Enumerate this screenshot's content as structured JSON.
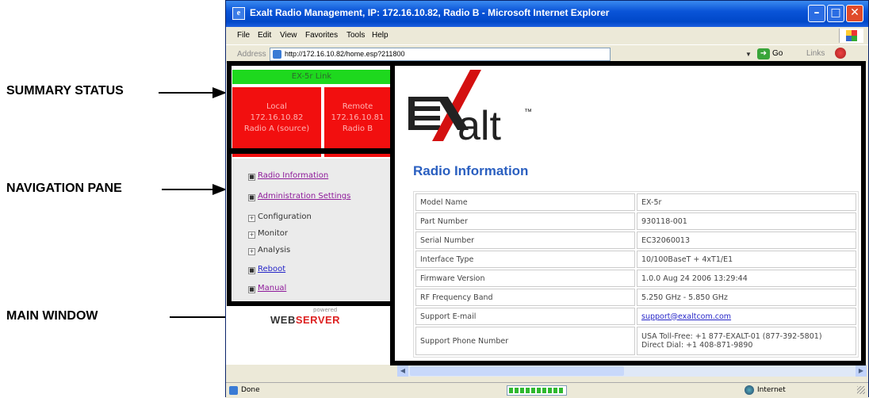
{
  "callouts": {
    "summary_status": "SUMMARY STATUS",
    "navigation_pane": "NAVIGATION PANE",
    "main_window": "MAIN WINDOW"
  },
  "window": {
    "title": "Exalt Radio Management, IP: 172.16.10.82, Radio B - Microsoft Internet Explorer",
    "minimize_glyph": "–",
    "maximize_glyph": "□",
    "close_glyph": "✕"
  },
  "menu": [
    "File",
    "Edit",
    "View",
    "Favorites",
    "Tools",
    "Help"
  ],
  "address": {
    "label": "Address",
    "url": "http://172.16.10.82/home.esp?211800",
    "go": "Go",
    "links": "Links"
  },
  "summary": {
    "link_label": "EX-5r Link",
    "local": [
      "Local",
      "172.16.10.82",
      "Radio A (source)"
    ],
    "remote": [
      "Remote",
      "172.16.10.81",
      "Radio B"
    ]
  },
  "nav": {
    "items": [
      {
        "label": "Radio Information",
        "style": "purple"
      },
      {
        "label": "Administration Settings",
        "style": "purple"
      },
      {
        "label": "Configuration",
        "style": "plain"
      },
      {
        "label": "Monitor",
        "style": "plain"
      },
      {
        "label": "Analysis",
        "style": "plain"
      },
      {
        "label": "Reboot",
        "style": "blue"
      },
      {
        "label": "Manual",
        "style": "purple"
      }
    ]
  },
  "webserver": {
    "small": "powered",
    "web": "WEB",
    "server": "SERVER"
  },
  "main": {
    "logo_text": "alt",
    "logo_tm": "™",
    "section_title": "Radio Information",
    "rows": [
      {
        "label": "Model Name",
        "value": "EX-5r"
      },
      {
        "label": "Part Number",
        "value": "930118-001"
      },
      {
        "label": "Serial Number",
        "value": "EC32060013"
      },
      {
        "label": "Interface Type",
        "value": "10/100BaseT + 4xT1/E1"
      },
      {
        "label": "Firmware Version",
        "value": "1.0.0 Aug 24 2006 13:29:44"
      },
      {
        "label": "RF Frequency Band",
        "value": "5.250 GHz - 5.850 GHz"
      },
      {
        "label": "Support E-mail",
        "value": "support@exaltcom.com"
      },
      {
        "label": "Support Phone Number",
        "value": "USA Toll-Free: +1 877-EXALT-01 (877-392-5801)",
        "value2": "Direct Dial: +1 408-871-9890"
      }
    ]
  },
  "status": {
    "done": "Done",
    "zone": "Internet",
    "progress": 1.0
  },
  "colors": {
    "link_green": "#1ed81e",
    "radio_red": "#f20f0f",
    "title_blue": "#2a5fc0",
    "exalt_red": "#d41010"
  }
}
